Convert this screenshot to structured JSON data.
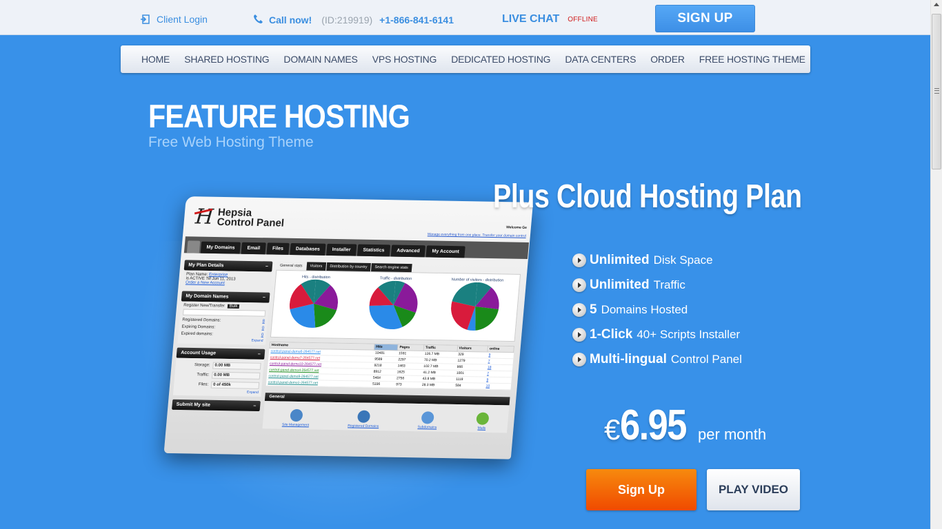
{
  "topbar": {
    "client_login": "Client Login",
    "call_now": "Call now!",
    "call_id": "(ID:219919)",
    "phone": "+1-866-841-6141",
    "live_chat": "LIVE CHAT",
    "chat_status": "OFFLINE",
    "signup": "SIGN UP"
  },
  "nav": {
    "items": [
      "HOME",
      "SHARED HOSTING",
      "DOMAIN NAMES",
      "VPS HOSTING",
      "DEDICATED HOSTING",
      "DATA CENTERS",
      "ORDER",
      "FREE HOSTING THEME"
    ]
  },
  "hero": {
    "title": "FEATURE HOSTING",
    "subtitle": "Free Web Hosting Theme",
    "plan_title": "Plus Cloud Hosting Plan"
  },
  "features": [
    {
      "bold": "Unlimited",
      "text": "Disk Space"
    },
    {
      "bold": "Unlimited",
      "text": "Traffic"
    },
    {
      "bold": "5",
      "text": "Domains Hosted"
    },
    {
      "bold": "1-Click",
      "text": "40+ Scripts Installer"
    },
    {
      "bold": "Multi-lingual",
      "text": "Control Panel"
    }
  ],
  "price": {
    "currency": "€",
    "amount": "6.95",
    "period": "per month"
  },
  "buttons": {
    "signup": "Sign Up",
    "play_video": "PLAY VIDEO"
  },
  "colors": {
    "background": "#3891e9",
    "accent_blue": "#3a8ee0",
    "signup_orange": "#f04a00",
    "offline_red": "#d01c1c"
  },
  "control_panel": {
    "brand_line1": "Hepsia",
    "brand_line2": "Control Panel",
    "welcome": "Welcome Ge",
    "manage_msg": "Manage everything from one place. Transfer your domain control",
    "tabs": [
      "My Domains",
      "Email",
      "Files",
      "Databases",
      "Installer",
      "Statistics",
      "Advanced",
      "My Account"
    ],
    "plan_box": {
      "title": "My Plan Details",
      "plan_label": "Plan Name:",
      "plan_name": "Enterprise",
      "active": "is ACTIVE Till Jun 11, 2013",
      "order": "Order a New Account"
    },
    "domain_box": {
      "title": "My Domain Names",
      "tab1": "Register New/Transfer",
      "tab2": "Bulk",
      "rows": [
        {
          "label": "Registered Domains:",
          "value": "8"
        },
        {
          "label": "Expiring Domains:",
          "value": "0"
        },
        {
          "label": "Expired domains:",
          "value": "0"
        }
      ],
      "expand": "Expand"
    },
    "usage_box": {
      "title": "Account Usage",
      "rows": [
        {
          "label": "Storage:",
          "value": "0.00 MB"
        },
        {
          "label": "Traffic:",
          "value": "0.00 MB"
        },
        {
          "label": "Files:",
          "value": "0 of 450k"
        }
      ],
      "expand": "Expand"
    },
    "submit_box": "Submit My site",
    "stat_tabs": [
      "General stats",
      "Visitors",
      "Distribution by country",
      "Search engine stats"
    ],
    "charts": [
      {
        "title": "Hits - distribution"
      },
      {
        "title": "Traffic - distribution"
      },
      {
        "title": "Number of visitors - distribution"
      }
    ],
    "table": {
      "headers": [
        "Hostname",
        "Hits",
        "Pages",
        "Traffic",
        "Visitors",
        "online"
      ],
      "rows": [
        [
          "control-panel-demo6-264577.net",
          "10481",
          "1591",
          "126.7 MB",
          "329",
          "9"
        ],
        [
          "control-panel-demo7-264577.net",
          "9589",
          "2297",
          "70.2 MB",
          "1279",
          "7"
        ],
        [
          "control-panel-demo10-264577.net",
          "9218",
          "1463",
          "102.7 MB",
          "966",
          "18"
        ],
        [
          "control-panel-demo4-264577.net",
          "8912",
          "1625",
          "41.2 MB",
          "1001",
          "7"
        ],
        [
          "control-panel-demo9-264577.net",
          "5464",
          "2756",
          "43.8 MB",
          "1119",
          "9"
        ],
        [
          "control-panel-demo1-264577.net",
          "5336",
          "973",
          "28.3 MB",
          "584",
          "10"
        ]
      ],
      "link_colors": [
        "#2a8ae8",
        "#d81b3c",
        "#8a1a9a",
        "#1a8a1a",
        "#1a8a8a",
        "#1a8a8a"
      ]
    },
    "general": {
      "title": "General",
      "items": [
        "Site Management",
        "Registered Domains",
        "Subdomains",
        "Mails"
      ]
    }
  }
}
